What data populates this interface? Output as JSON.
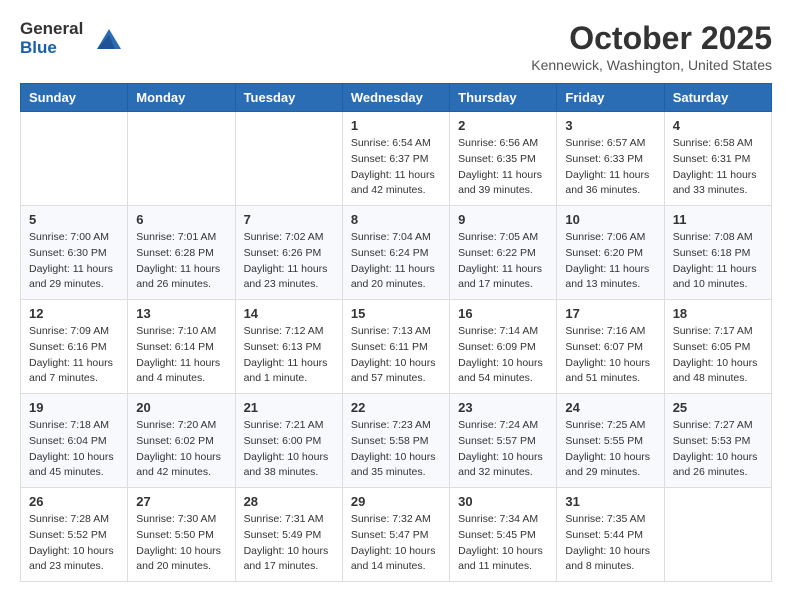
{
  "header": {
    "logo_line1": "General",
    "logo_line2": "Blue",
    "month_title": "October 2025",
    "location": "Kennewick, Washington, United States"
  },
  "days_of_week": [
    "Sunday",
    "Monday",
    "Tuesday",
    "Wednesday",
    "Thursday",
    "Friday",
    "Saturday"
  ],
  "weeks": [
    [
      {
        "day": "",
        "info": ""
      },
      {
        "day": "",
        "info": ""
      },
      {
        "day": "",
        "info": ""
      },
      {
        "day": "1",
        "info": "Sunrise: 6:54 AM\nSunset: 6:37 PM\nDaylight: 11 hours\nand 42 minutes."
      },
      {
        "day": "2",
        "info": "Sunrise: 6:56 AM\nSunset: 6:35 PM\nDaylight: 11 hours\nand 39 minutes."
      },
      {
        "day": "3",
        "info": "Sunrise: 6:57 AM\nSunset: 6:33 PM\nDaylight: 11 hours\nand 36 minutes."
      },
      {
        "day": "4",
        "info": "Sunrise: 6:58 AM\nSunset: 6:31 PM\nDaylight: 11 hours\nand 33 minutes."
      }
    ],
    [
      {
        "day": "5",
        "info": "Sunrise: 7:00 AM\nSunset: 6:30 PM\nDaylight: 11 hours\nand 29 minutes."
      },
      {
        "day": "6",
        "info": "Sunrise: 7:01 AM\nSunset: 6:28 PM\nDaylight: 11 hours\nand 26 minutes."
      },
      {
        "day": "7",
        "info": "Sunrise: 7:02 AM\nSunset: 6:26 PM\nDaylight: 11 hours\nand 23 minutes."
      },
      {
        "day": "8",
        "info": "Sunrise: 7:04 AM\nSunset: 6:24 PM\nDaylight: 11 hours\nand 20 minutes."
      },
      {
        "day": "9",
        "info": "Sunrise: 7:05 AM\nSunset: 6:22 PM\nDaylight: 11 hours\nand 17 minutes."
      },
      {
        "day": "10",
        "info": "Sunrise: 7:06 AM\nSunset: 6:20 PM\nDaylight: 11 hours\nand 13 minutes."
      },
      {
        "day": "11",
        "info": "Sunrise: 7:08 AM\nSunset: 6:18 PM\nDaylight: 11 hours\nand 10 minutes."
      }
    ],
    [
      {
        "day": "12",
        "info": "Sunrise: 7:09 AM\nSunset: 6:16 PM\nDaylight: 11 hours\nand 7 minutes."
      },
      {
        "day": "13",
        "info": "Sunrise: 7:10 AM\nSunset: 6:14 PM\nDaylight: 11 hours\nand 4 minutes."
      },
      {
        "day": "14",
        "info": "Sunrise: 7:12 AM\nSunset: 6:13 PM\nDaylight: 11 hours\nand 1 minute."
      },
      {
        "day": "15",
        "info": "Sunrise: 7:13 AM\nSunset: 6:11 PM\nDaylight: 10 hours\nand 57 minutes."
      },
      {
        "day": "16",
        "info": "Sunrise: 7:14 AM\nSunset: 6:09 PM\nDaylight: 10 hours\nand 54 minutes."
      },
      {
        "day": "17",
        "info": "Sunrise: 7:16 AM\nSunset: 6:07 PM\nDaylight: 10 hours\nand 51 minutes."
      },
      {
        "day": "18",
        "info": "Sunrise: 7:17 AM\nSunset: 6:05 PM\nDaylight: 10 hours\nand 48 minutes."
      }
    ],
    [
      {
        "day": "19",
        "info": "Sunrise: 7:18 AM\nSunset: 6:04 PM\nDaylight: 10 hours\nand 45 minutes."
      },
      {
        "day": "20",
        "info": "Sunrise: 7:20 AM\nSunset: 6:02 PM\nDaylight: 10 hours\nand 42 minutes."
      },
      {
        "day": "21",
        "info": "Sunrise: 7:21 AM\nSunset: 6:00 PM\nDaylight: 10 hours\nand 38 minutes."
      },
      {
        "day": "22",
        "info": "Sunrise: 7:23 AM\nSunset: 5:58 PM\nDaylight: 10 hours\nand 35 minutes."
      },
      {
        "day": "23",
        "info": "Sunrise: 7:24 AM\nSunset: 5:57 PM\nDaylight: 10 hours\nand 32 minutes."
      },
      {
        "day": "24",
        "info": "Sunrise: 7:25 AM\nSunset: 5:55 PM\nDaylight: 10 hours\nand 29 minutes."
      },
      {
        "day": "25",
        "info": "Sunrise: 7:27 AM\nSunset: 5:53 PM\nDaylight: 10 hours\nand 26 minutes."
      }
    ],
    [
      {
        "day": "26",
        "info": "Sunrise: 7:28 AM\nSunset: 5:52 PM\nDaylight: 10 hours\nand 23 minutes."
      },
      {
        "day": "27",
        "info": "Sunrise: 7:30 AM\nSunset: 5:50 PM\nDaylight: 10 hours\nand 20 minutes."
      },
      {
        "day": "28",
        "info": "Sunrise: 7:31 AM\nSunset: 5:49 PM\nDaylight: 10 hours\nand 17 minutes."
      },
      {
        "day": "29",
        "info": "Sunrise: 7:32 AM\nSunset: 5:47 PM\nDaylight: 10 hours\nand 14 minutes."
      },
      {
        "day": "30",
        "info": "Sunrise: 7:34 AM\nSunset: 5:45 PM\nDaylight: 10 hours\nand 11 minutes."
      },
      {
        "day": "31",
        "info": "Sunrise: 7:35 AM\nSunset: 5:44 PM\nDaylight: 10 hours\nand 8 minutes."
      },
      {
        "day": "",
        "info": ""
      }
    ]
  ]
}
